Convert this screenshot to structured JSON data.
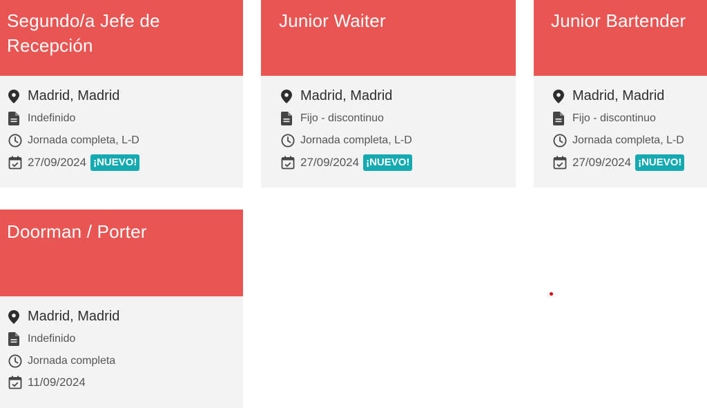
{
  "jobs": [
    {
      "title": "Segundo/a Jefe de Recepción",
      "location": "Madrid, Madrid",
      "contract": "Indefinido",
      "schedule": "Jornada completa, L-D",
      "date": "27/09/2024",
      "badge": "¡NUEVO!"
    },
    {
      "title": "Junior Waiter",
      "location": "Madrid, Madrid",
      "contract": "Fijo - discontinuo",
      "schedule": "Jornada completa, L-D",
      "date": "27/09/2024",
      "badge": "¡NUEVO!"
    },
    {
      "title": "Junior Bartender",
      "location": "Madrid, Madrid",
      "contract": "Fijo - discontinuo",
      "schedule": "Jornada completa, L-D",
      "date": "27/09/2024",
      "badge": "¡NUEVO!"
    },
    {
      "title": "Doorman / Porter",
      "location": "Madrid, Madrid",
      "contract": "Indefinido",
      "schedule": "Jornada completa",
      "date": "11/09/2024"
    }
  ],
  "icons": {
    "location": "map-pin-icon",
    "contract": "document-icon",
    "schedule": "clock-icon",
    "date": "calendar-check-icon"
  },
  "colors": {
    "header": "#e85552",
    "card_bg": "#f3f3f3",
    "badge": "#15aab1"
  }
}
